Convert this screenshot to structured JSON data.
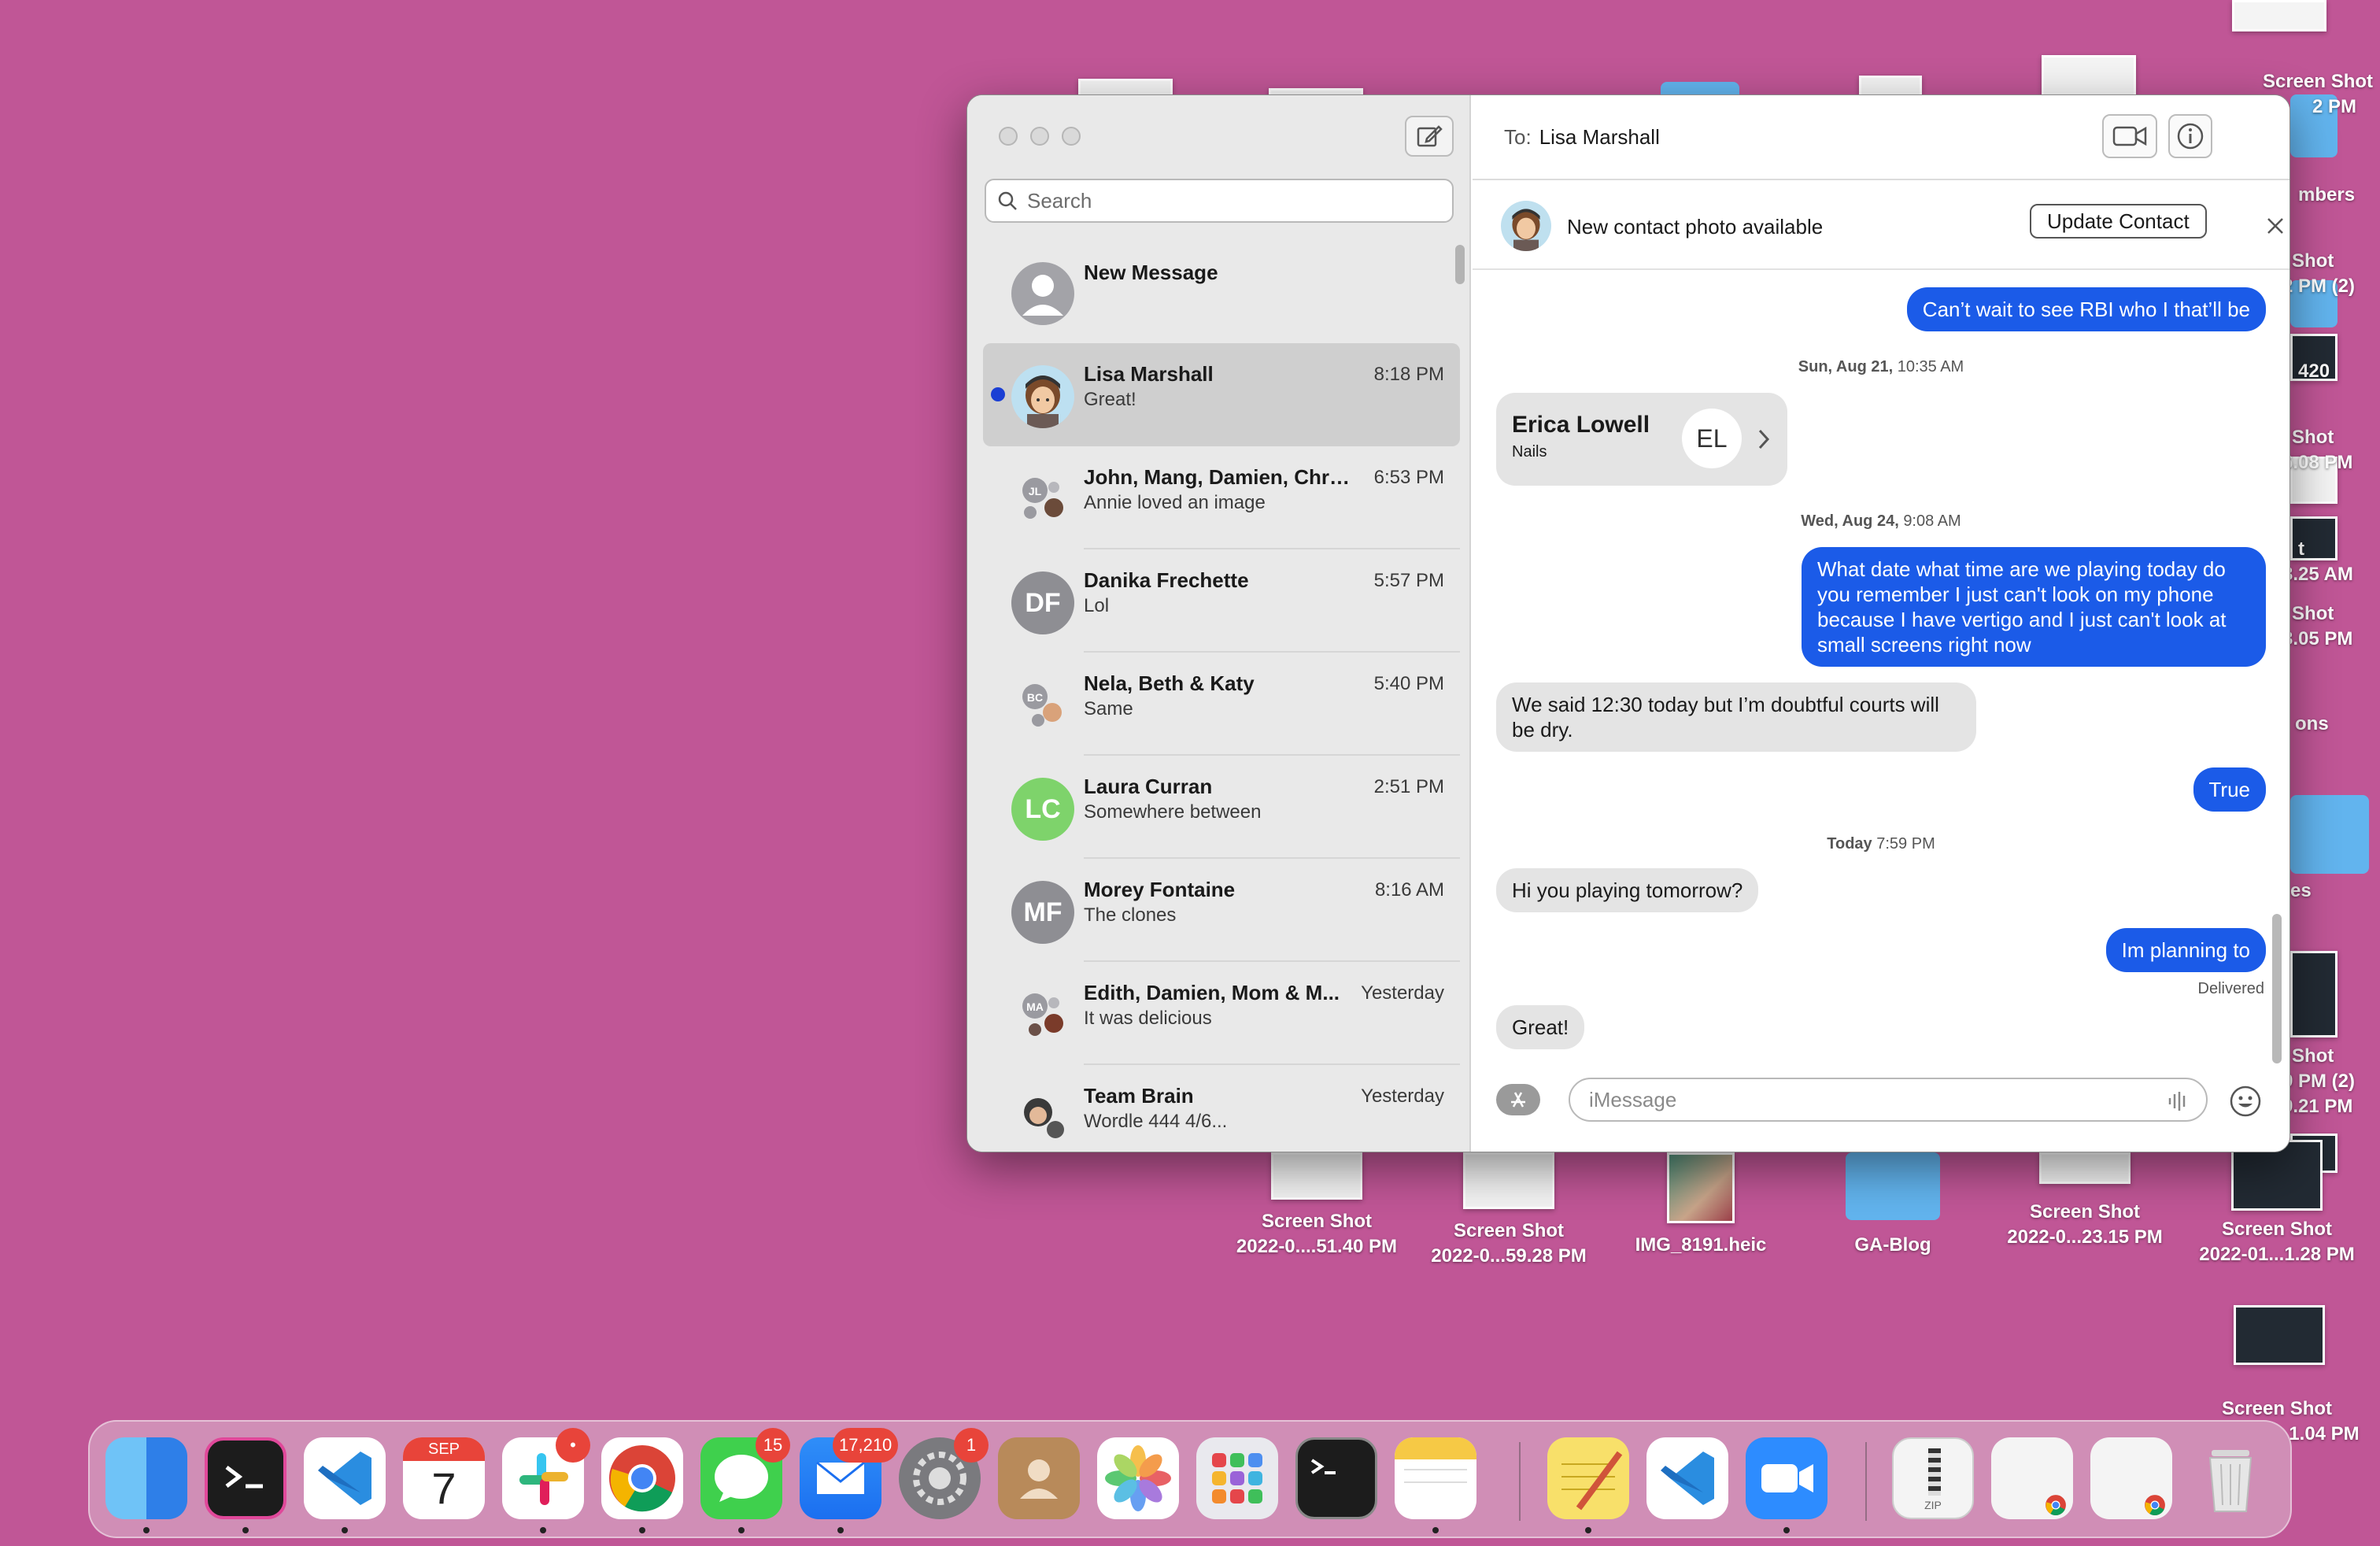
{
  "desktop": {
    "right_column": [
      {
        "line1": "Screen Shot",
        "line2": "2 PM"
      },
      {
        "line1": "mbers",
        "line2": ""
      },
      {
        "line1": "Shot",
        "line2": "2 PM (2)"
      },
      {
        "line1": "420",
        "line2": ""
      },
      {
        "line1": "Shot",
        "line2": "6.08 PM"
      },
      {
        "line1": "t",
        "line2": "3.25 AM"
      },
      {
        "line1": "Shot",
        "line2": "3.05 PM"
      },
      {
        "line1": "ons",
        "line2": ""
      },
      {
        "line1": "es",
        "line2": ""
      },
      {
        "line1": "Shot",
        "line2": "9 PM (2)"
      },
      {
        "line1": "",
        "line2": "9.21 PM"
      }
    ],
    "bottom_row": [
      {
        "line1": "Screen Shot",
        "line2": "2022-0....51.40 PM"
      },
      {
        "line1": "Screen Shot",
        "line2": "2022-0...59.28 PM"
      },
      {
        "line1": "IMG_8191.heic",
        "line2": ""
      },
      {
        "line1": "GA-Blog",
        "line2": ""
      },
      {
        "line1": "Screen Shot",
        "line2": "2022-0...23.15 PM"
      },
      {
        "line1": "Screen Shot",
        "line2": "2022-01...1.28 PM"
      }
    ],
    "corner": {
      "line1": "Screen Shot",
      "line2": "1.04 PM"
    }
  },
  "window": {
    "search_placeholder": "Search",
    "conversations": [
      {
        "name": "New Message",
        "time": "",
        "preview": "",
        "avatar": "person-icon",
        "selected": false
      },
      {
        "name": "Lisa Marshall",
        "time": "8:18 PM",
        "preview": "Great!",
        "avatar": "memoji",
        "selected": true,
        "unread": true
      },
      {
        "name": "John, Mang, Damien, Chri...",
        "time": "6:53 PM",
        "preview": "Annie loved an image",
        "avatar": "group"
      },
      {
        "name": "Danika Frechette",
        "time": "5:57 PM",
        "preview": "Lol",
        "avatar": "DF",
        "color": "#8e8e93"
      },
      {
        "name": "Nela, Beth & Katy",
        "time": "5:40 PM",
        "preview": "Same",
        "avatar": "group"
      },
      {
        "name": "Laura Curran",
        "time": "2:51 PM",
        "preview": "Somewhere between",
        "avatar": "LC",
        "color": "#7ed36b"
      },
      {
        "name": "Morey Fontaine",
        "time": "8:16 AM",
        "preview": "The clones",
        "avatar": "MF",
        "color": "#8e8e93"
      },
      {
        "name": "Edith, Damien, Mom & M...",
        "time": "Yesterday",
        "preview": "It was delicious",
        "avatar": "group"
      },
      {
        "name": "Team Brain",
        "time": "Yesterday",
        "preview": "Wordle 444 4/6...",
        "avatar": "group"
      }
    ],
    "chat": {
      "to_label": "To:",
      "recipient": "Lisa Marshall",
      "banner_text": "New contact photo available",
      "update_button": "Update Contact",
      "messages": {
        "m1": "Can’t wait to see RBI who I that’ll be",
        "stamp1_day": "Sun, Aug 21,",
        "stamp1_time": "10:35 AM",
        "card_name": "Erica Lowell",
        "card_sub": "Nails",
        "card_initials": "EL",
        "stamp2_day": "Wed, Aug 24,",
        "stamp2_time": "9:08 AM",
        "m2": "What date what time are we playing today do you remember I just can't look on my phone because I have vertigo and I just can't look at small screens right now",
        "m3": "We said 12:30 today but I’m doubtful courts will be dry.",
        "m4": "True",
        "stamp3_day": "Today",
        "stamp3_time": "7:59 PM",
        "m5": "Hi you playing tomorrow?",
        "m6": "Im planning to",
        "delivered": "Delivered",
        "m7": "Great!"
      },
      "input_placeholder": "iMessage"
    }
  },
  "dock": {
    "calendar_month": "SEP",
    "calendar_day": "7",
    "messages_badge": "15",
    "mail_badge": "17,210",
    "settings_badge": "1",
    "slack_badge": "•",
    "zip_label": "ZIP"
  }
}
